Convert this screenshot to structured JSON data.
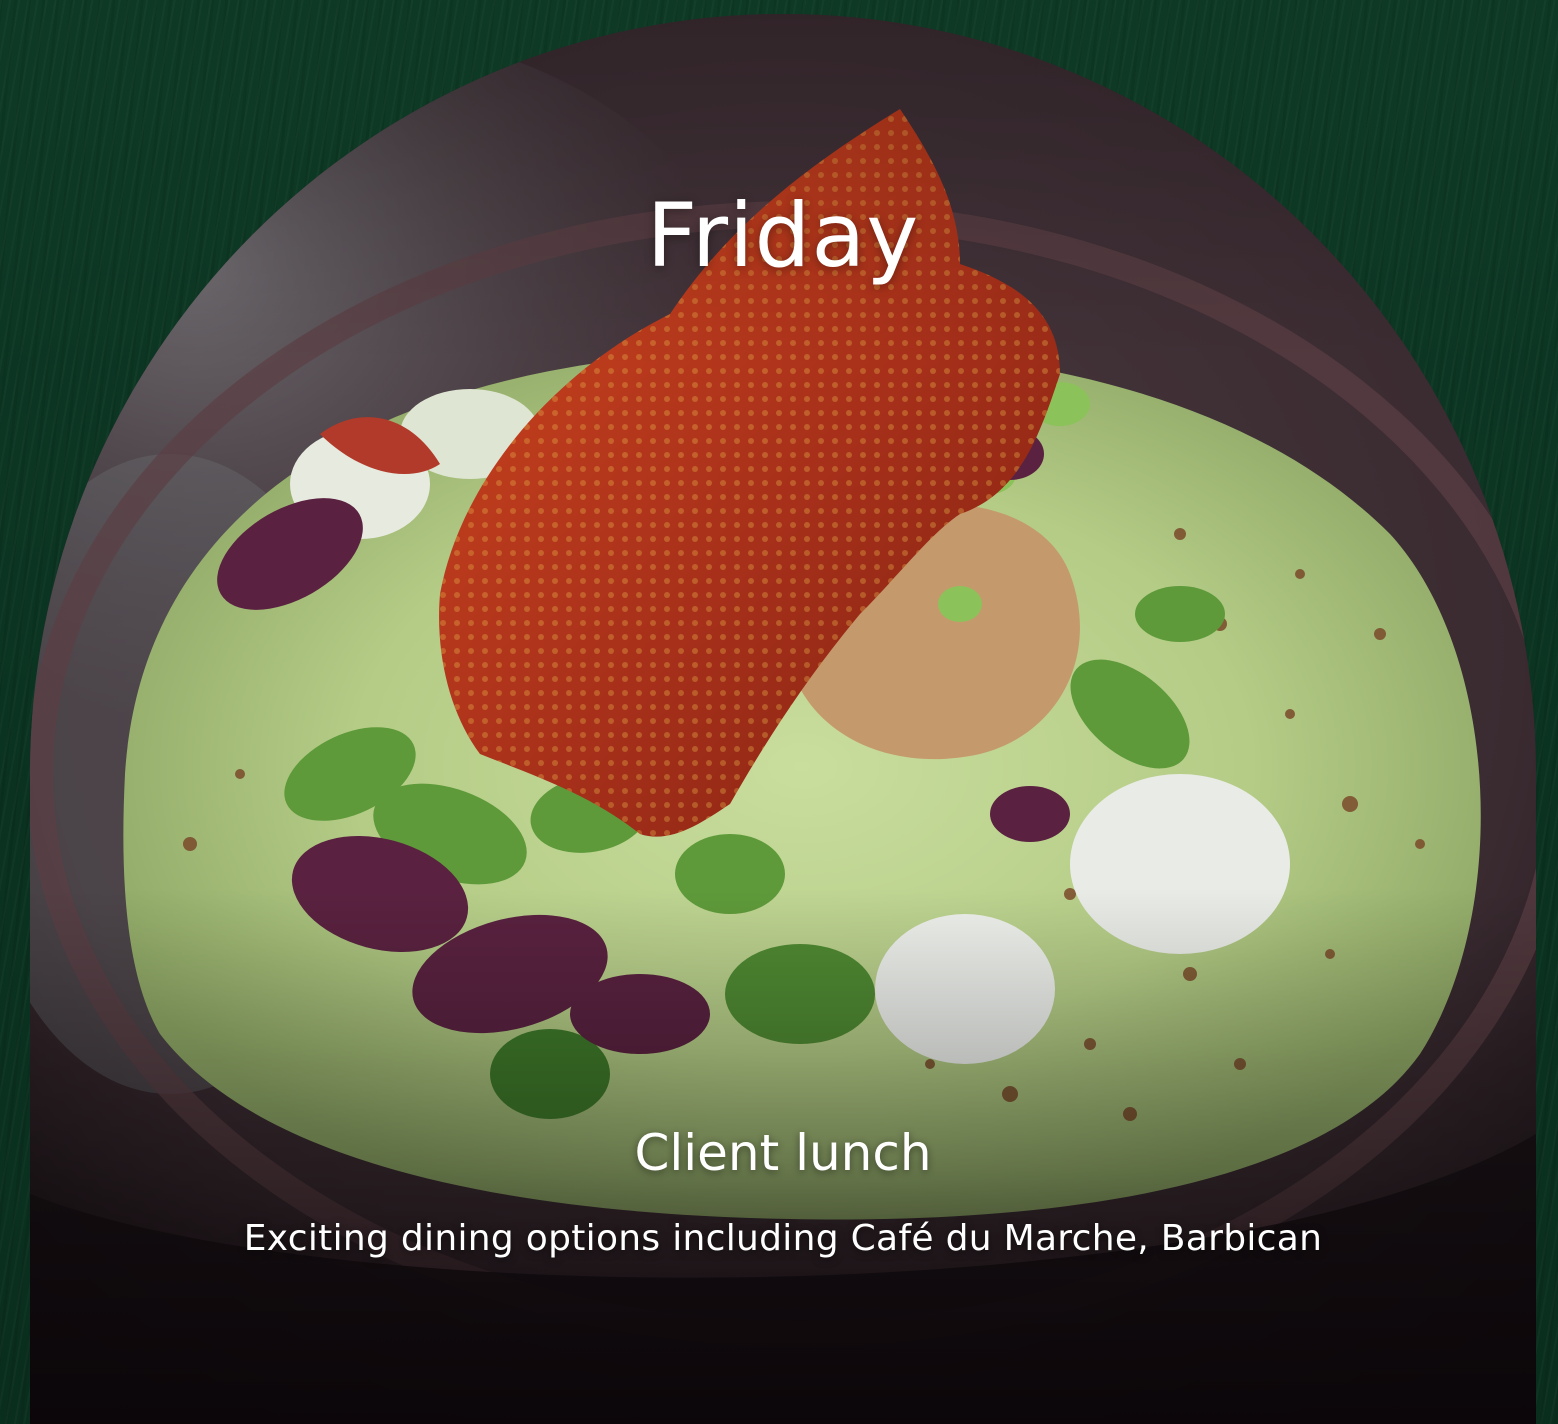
{
  "card": {
    "day": "Friday",
    "event_title": "Client lunch",
    "event_description": "Exciting dining options including Café du Marche, Barbican",
    "image": "gourmet-dish-photo"
  },
  "colors": {
    "page_background": "#0b3321",
    "text": "#ffffff",
    "sauce_green": "#b7cf8a",
    "bowl": "#3a2d33",
    "crisp_red": "#b8361b"
  }
}
